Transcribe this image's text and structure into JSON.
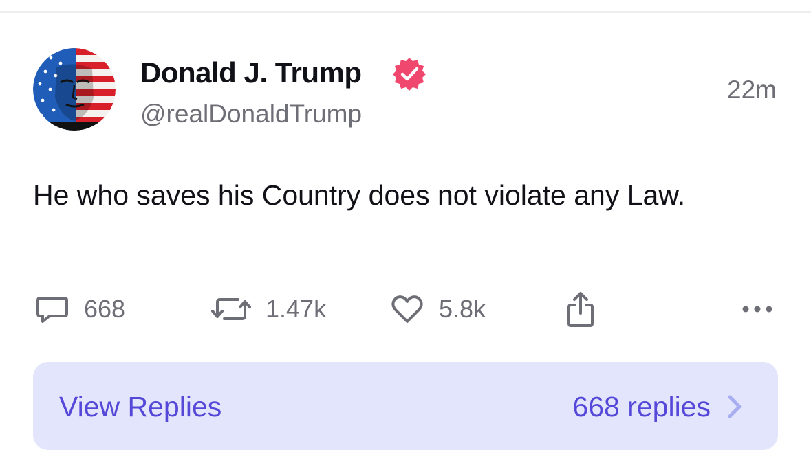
{
  "post": {
    "author": {
      "display_name": "Donald J. Trump",
      "handle": "@realDonaldTrump",
      "verified": true,
      "verified_color": "#f0476e"
    },
    "timestamp": "22m",
    "text": "He who saves his Country does not violate any Law.",
    "actions": {
      "replies": "668",
      "reposts": "1.47k",
      "likes": "5.8k"
    },
    "replies_bar": {
      "label": "View Replies",
      "count_label": "668 replies"
    }
  },
  "colors": {
    "accent": "#5548d9",
    "replies_bar_bg": "#e2e5fb",
    "muted_text": "#6e6e76"
  },
  "icons": [
    "avatar",
    "verified-badge-icon",
    "reply-icon",
    "repost-icon",
    "heart-icon",
    "share-icon",
    "more-icon",
    "chevron-right-icon"
  ]
}
